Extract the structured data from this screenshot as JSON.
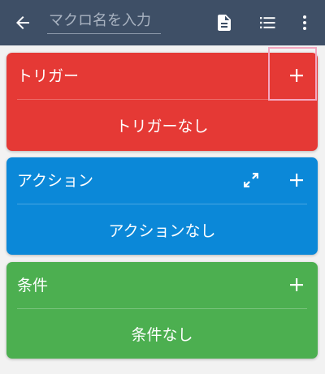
{
  "toolbar": {
    "macro_name_value": "",
    "macro_name_placeholder": "マクロ名を入力",
    "icons": {
      "back": "arrow-left-icon",
      "document": "document-icon",
      "list": "list-icon",
      "more": "more-vert-icon"
    },
    "background_color": "#3e4f66"
  },
  "sections": {
    "trigger": {
      "title": "トリガー",
      "empty_text": "トリガーなし",
      "color": "#e53935",
      "add_icon": "plus-icon"
    },
    "action": {
      "title": "アクション",
      "empty_text": "アクションなし",
      "color": "#0b88d8",
      "add_icon": "plus-icon",
      "expand_icon": "expand-icon"
    },
    "constraint": {
      "title": "条件",
      "empty_text": "条件なし",
      "color": "#4caf50",
      "add_icon": "plus-icon"
    }
  },
  "highlight_color": "#f4a7c0"
}
